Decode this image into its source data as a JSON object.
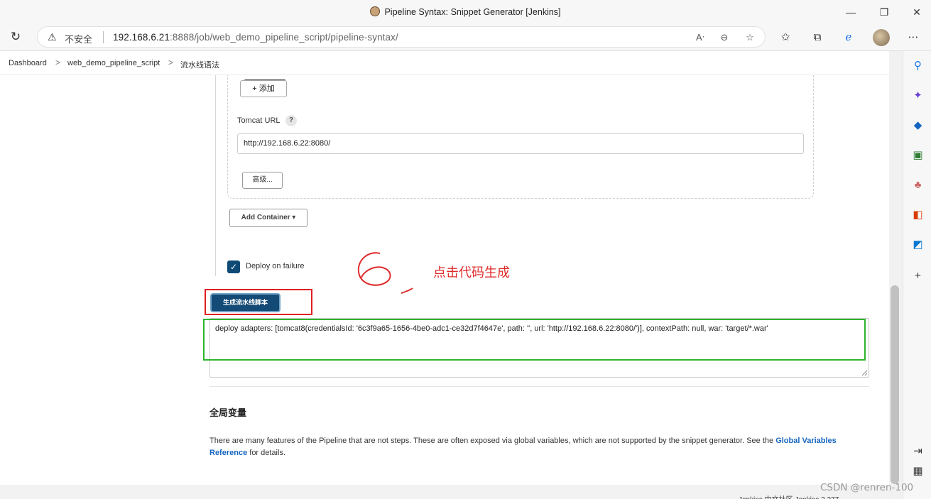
{
  "browser": {
    "tab_title": "Pipeline Syntax: Snippet Generator [Jenkins]",
    "insecure_label": "不安全",
    "url_host": "192.168.6.21",
    "url_rest": ":8888/job/web_demo_pipeline_script/pipeline-syntax/",
    "window_controls": [
      "—",
      "❐",
      "✕"
    ]
  },
  "breadcrumb": {
    "items": [
      "Dashboard",
      "web_demo_pipeline_script",
      "流水线语法"
    ],
    "separator": ">"
  },
  "form": {
    "add_button_label": "添加",
    "tomcat_url_label": "Tomcat URL",
    "help_label": "?",
    "tomcat_url_value": "http://192.168.6.22:8080/",
    "advanced_button_label": "高级...",
    "add_container_label": "Add Container",
    "deploy_on_failure_label": "Deploy on failure",
    "deploy_on_failure_checked": true
  },
  "annotation": {
    "step_number": "6",
    "note": "点击代码生成",
    "color": "#e02a2a",
    "highlight_color": "#2db52d"
  },
  "generator": {
    "generate_button_label": "生成流水线脚本",
    "snippet": "deploy adapters: [tomcat8(credentialsId: '6c3f9a65-1656-4be0-adc1-ce32d7f4647e', path: '', url: 'http://192.168.6.22:8080/')], contextPath: null, war: 'target/*.war'"
  },
  "global_vars": {
    "heading": "全局变量",
    "text_before": "There are many features of the Pipeline that are not steps. These are often exposed via global variables, which are not supported by the snippet generator. See the ",
    "link_text": "Global Variables Reference",
    "text_after": " for details."
  },
  "footer": {
    "text": "Jenkins 中文社区    Jenkins 2.277"
  },
  "watermark": "CSDN @renren-100"
}
